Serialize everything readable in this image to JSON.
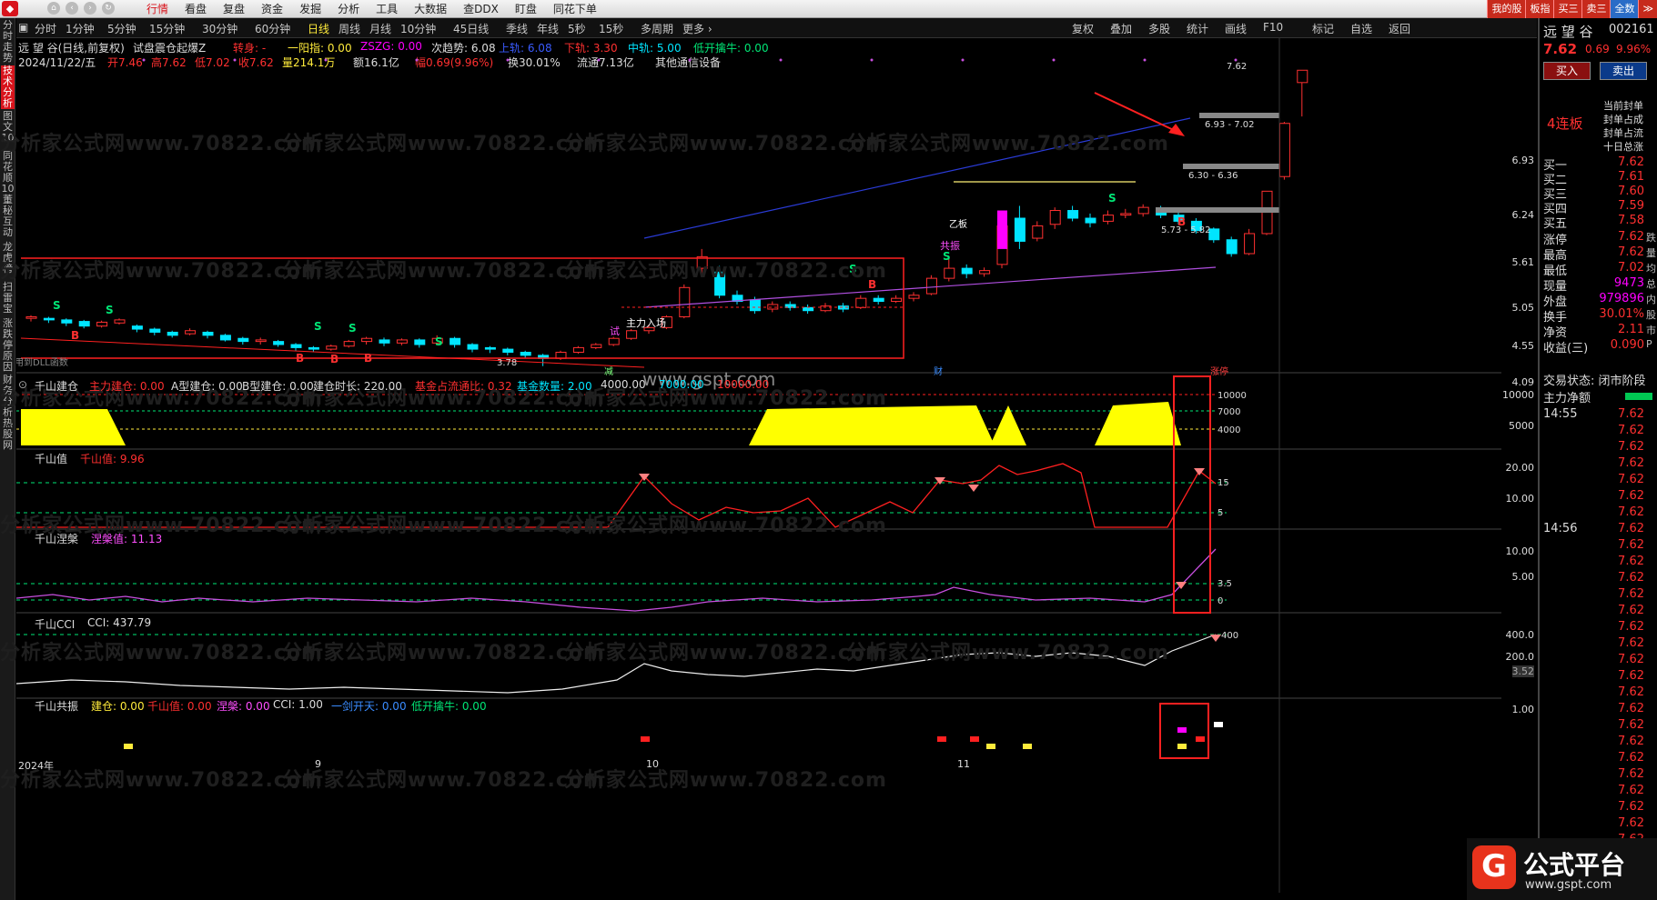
{
  "menu_bar": {
    "items": [
      "行情",
      "看盘",
      "复盘",
      "资金",
      "发掘",
      "分析",
      "工具",
      "大数据",
      "查DDX",
      "盯盘",
      "同花下单"
    ],
    "right_buttons": [
      "我的股",
      "板指",
      "买三",
      "卖三",
      "全数",
      "≫"
    ]
  },
  "left_tabs": [
    "分时走势",
    "技术分析",
    "图文10",
    "同花顺10",
    "董秘互动",
    "龙虎榜",
    "扫雷宝",
    "涨跌停原因",
    "财务分析",
    "热股网"
  ],
  "periods": [
    "分时",
    "1分钟",
    "5分钟",
    "15分钟",
    "30分钟",
    "60分钟",
    "日线",
    "周线",
    "月线",
    "10分钟",
    "45日线",
    "季线",
    "年线",
    "5秒",
    "15秒",
    "多周期",
    "更多 ›"
  ],
  "active_period": "日线",
  "tool_buttons": [
    "复权",
    "叠加",
    "多股",
    "统计",
    "画线",
    "F10",
    "标记",
    "自选",
    "返回"
  ],
  "chart_info": {
    "name_line": "远 望 谷(日线,前复权)",
    "indicator_name": "试盘震仓起爆Z",
    "turn": "转身: -",
    "yiyang": "一阳指: 0.00",
    "zszg": "ZSZG: 0.00",
    "trend": "次趋势: 6.08",
    "up_rail": "上轨: 6.08",
    "down_rail": "下轨: 3.30",
    "mid_rail": "中轨: 5.00",
    "low_open": "低开擒牛: 0.00",
    "date_line": "2024/11/22/五",
    "open": "开7.46",
    "high": "高7.62",
    "low": "低7.02",
    "close": "收7.62",
    "volume": "量214.1万",
    "amount": "额16.1亿",
    "change": "幅0.69(9.96%)",
    "turnover": "换30.01%",
    "float_cap": "流通7.13亿",
    "sector": "其他通信设备",
    "dll_note": "用到DLL函数"
  },
  "annotations": {
    "main_force": "主力入场",
    "resonance": "共振",
    "limit_up": "涨停",
    "test": "试",
    "board_count": "4连板",
    "watermark_site": "www.gspt.com",
    "price_boxes": [
      "6.93 - 7.02",
      "6.30 - 6.36",
      "5.73 - 5.82"
    ],
    "top_price": "7.62",
    "low_price": "3.78",
    "bottom_tags": [
      "减",
      "财",
      "涨停"
    ],
    "gain_tag": "乙板"
  },
  "main_axis": [
    "6.93",
    "6.24",
    "5.61",
    "5.05",
    "4.55",
    "4.09"
  ],
  "panel1": {
    "title": "千山建仓",
    "items": [
      "主力建仓: 0.00",
      "A型建仓: 0.00",
      "B型建仓: 0.00",
      "建仓时长: 220.00",
      "基金占流通比: 0.32",
      "基金数量: 2.00",
      "4000.00",
      "7000.00",
      "10000.00"
    ],
    "levels": [
      "10000",
      "7000",
      "4000"
    ],
    "axis": [
      "10000",
      "5000"
    ]
  },
  "panel2": {
    "title": "千山值",
    "value": "千山值: 9.96",
    "levels": [
      "15",
      "5"
    ],
    "axis": [
      "20.00",
      "10.00"
    ]
  },
  "panel3": {
    "title": "千山涅槃",
    "value": "涅槃值: 11.13",
    "levels": [
      "3.5",
      "0"
    ],
    "axis": [
      "10.00",
      "5.00"
    ]
  },
  "panel4": {
    "title": "千山CCI",
    "value": "CCI: 437.79",
    "levels": [
      "400"
    ],
    "axis": [
      "400.0",
      "200.0",
      "3.52"
    ]
  },
  "panel5": {
    "title": "千山共振",
    "items": [
      "建仓: 0.00",
      "千山值: 0.00",
      "涅槃: 0.00",
      "CCI: 1.00",
      "一剑开天: 0.00",
      "低开擒牛: 0.00"
    ],
    "axis": [
      "1.00"
    ]
  },
  "x_axis": [
    "2024年",
    "9",
    "10",
    "11"
  ],
  "watermark": "分析家公式网www.70822.com",
  "brand": {
    "name": "公式平台",
    "url": "www.gspt.com"
  },
  "quote": {
    "name": "远 望 谷",
    "code": "002161",
    "price": "7.62",
    "chg": "0.69",
    "pct": "9.96%",
    "buy_btn": "买入",
    "sell_btn": "卖出",
    "seal_lines": [
      "当前封单",
      "封单占成",
      "封单占流",
      "十日总涨"
    ],
    "book": [
      {
        "k": "买一",
        "v": "7.62"
      },
      {
        "k": "买二",
        "v": "7.61"
      },
      {
        "k": "买三",
        "v": "7.60"
      },
      {
        "k": "买四",
        "v": "7.59"
      },
      {
        "k": "买五",
        "v": "7.58"
      }
    ],
    "stats": [
      {
        "k": "涨停",
        "v": "7.62",
        "u": "跌"
      },
      {
        "k": "最高",
        "v": "7.62",
        "u": "量"
      },
      {
        "k": "最低",
        "v": "7.02",
        "u": "均"
      },
      {
        "k": "现量",
        "v": "9473",
        "u": "总"
      },
      {
        "k": "外盘",
        "v": "979896",
        "u": "内"
      },
      {
        "k": "换手",
        "v": "30.01%",
        "u": "股"
      },
      {
        "k": "净资",
        "v": "2.11",
        "u": "市"
      },
      {
        "k": "收益(三)",
        "v": "0.090",
        "u": "P"
      }
    ],
    "status": "交易状态: 闭市阶段",
    "net_flow": "主力净额",
    "ticks": [
      {
        "t": "14:55",
        "p": "7.62"
      },
      {
        "t": "",
        "p": "7.62"
      },
      {
        "t": "",
        "p": "7.62"
      },
      {
        "t": "",
        "p": "7.62"
      },
      {
        "t": "",
        "p": "7.62"
      },
      {
        "t": "",
        "p": "7.62"
      },
      {
        "t": "",
        "p": "7.62"
      },
      {
        "t": "14:56",
        "p": "7.62"
      },
      {
        "t": "",
        "p": "7.62"
      },
      {
        "t": "",
        "p": "7.62"
      },
      {
        "t": "",
        "p": "7.62"
      },
      {
        "t": "",
        "p": "7.62"
      },
      {
        "t": "",
        "p": "7.62"
      },
      {
        "t": "",
        "p": "7.62"
      },
      {
        "t": "",
        "p": "7.62"
      },
      {
        "t": "",
        "p": "7.62"
      },
      {
        "t": "",
        "p": "7.62"
      },
      {
        "t": "",
        "p": "7.62"
      },
      {
        "t": "",
        "p": "7.62"
      },
      {
        "t": "",
        "p": "7.62"
      },
      {
        "t": "",
        "p": "7.62"
      },
      {
        "t": "",
        "p": "7.62"
      },
      {
        "t": "",
        "p": "7.62"
      },
      {
        "t": "",
        "p": "7.62"
      },
      {
        "t": "",
        "p": "7.62"
      },
      {
        "t": "",
        "p": "7.62"
      },
      {
        "t": "",
        "p": "7.62"
      },
      {
        "t": "",
        "p": "7.62"
      },
      {
        "t": "",
        "p": "7.62"
      },
      {
        "t": "",
        "p": "7.62"
      },
      {
        "t": "",
        "p": "7.62"
      },
      {
        "t": "",
        "p": "7.62"
      }
    ]
  },
  "colors": {
    "up": "#ff3030",
    "down": "#00e5ff",
    "yellow": "#ffff00",
    "magenta": "#ff00ff",
    "blue": "#2a3bd6",
    "purple": "#b04fe0",
    "grid": "#2a2a2a"
  }
}
